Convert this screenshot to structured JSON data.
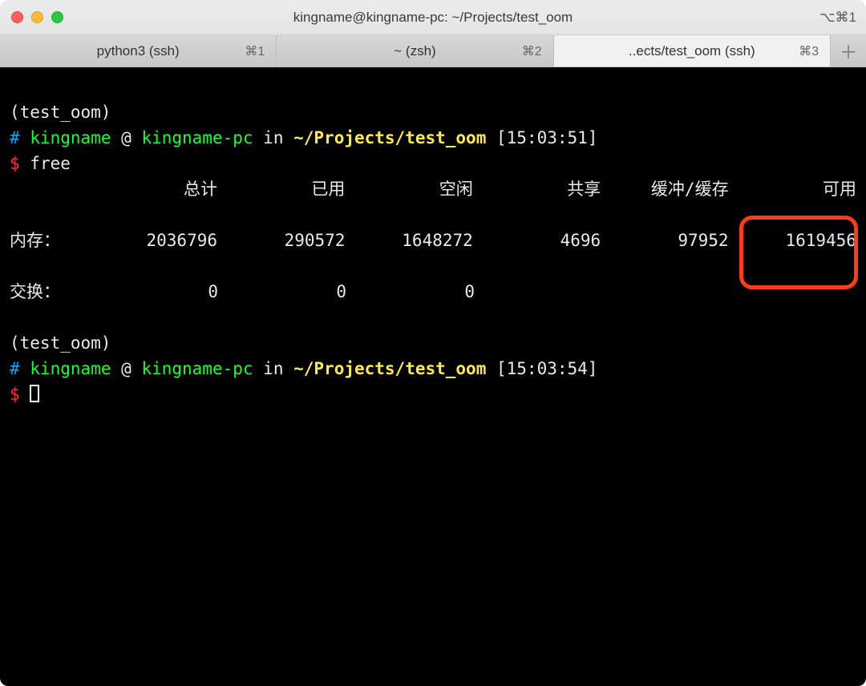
{
  "window": {
    "title": "kingname@kingname-pc: ~/Projects/test_oom",
    "right_indicator": "⌥⌘1"
  },
  "tabs": [
    {
      "label": "python3 (ssh)",
      "shortcut": "⌘1"
    },
    {
      "label": "~ (zsh)",
      "shortcut": "⌘2"
    },
    {
      "label": "..ects/test_oom (ssh)",
      "shortcut": "⌘3"
    }
  ],
  "prompt1": {
    "venv": "(test_oom)",
    "hash": "#",
    "user": "kingname",
    "at": "@",
    "host": "kingname-pc",
    "in": "in",
    "path": "~/Projects/test_oom",
    "time": "[15:03:51]",
    "sigil": "$",
    "command": "free"
  },
  "free": {
    "headers": {
      "total": "总计",
      "used": "已用",
      "free": "空闲",
      "shared": "共享",
      "buff": "缓冲/缓存",
      "avail": "可用"
    },
    "mem_label": "内存：",
    "swap_label": "交换：",
    "mem": {
      "total": "2036796",
      "used": "290572",
      "free": "1648272",
      "shared": "4696",
      "buff": "97952",
      "avail": "1619456"
    },
    "swap": {
      "total": "0",
      "used": "0",
      "free": "0"
    }
  },
  "prompt2": {
    "venv": "(test_oom)",
    "hash": "#",
    "user": "kingname",
    "at": "@",
    "host": "kingname-pc",
    "in": "in",
    "path": "~/Projects/test_oom",
    "time": "[15:03:54]",
    "sigil": "$"
  }
}
